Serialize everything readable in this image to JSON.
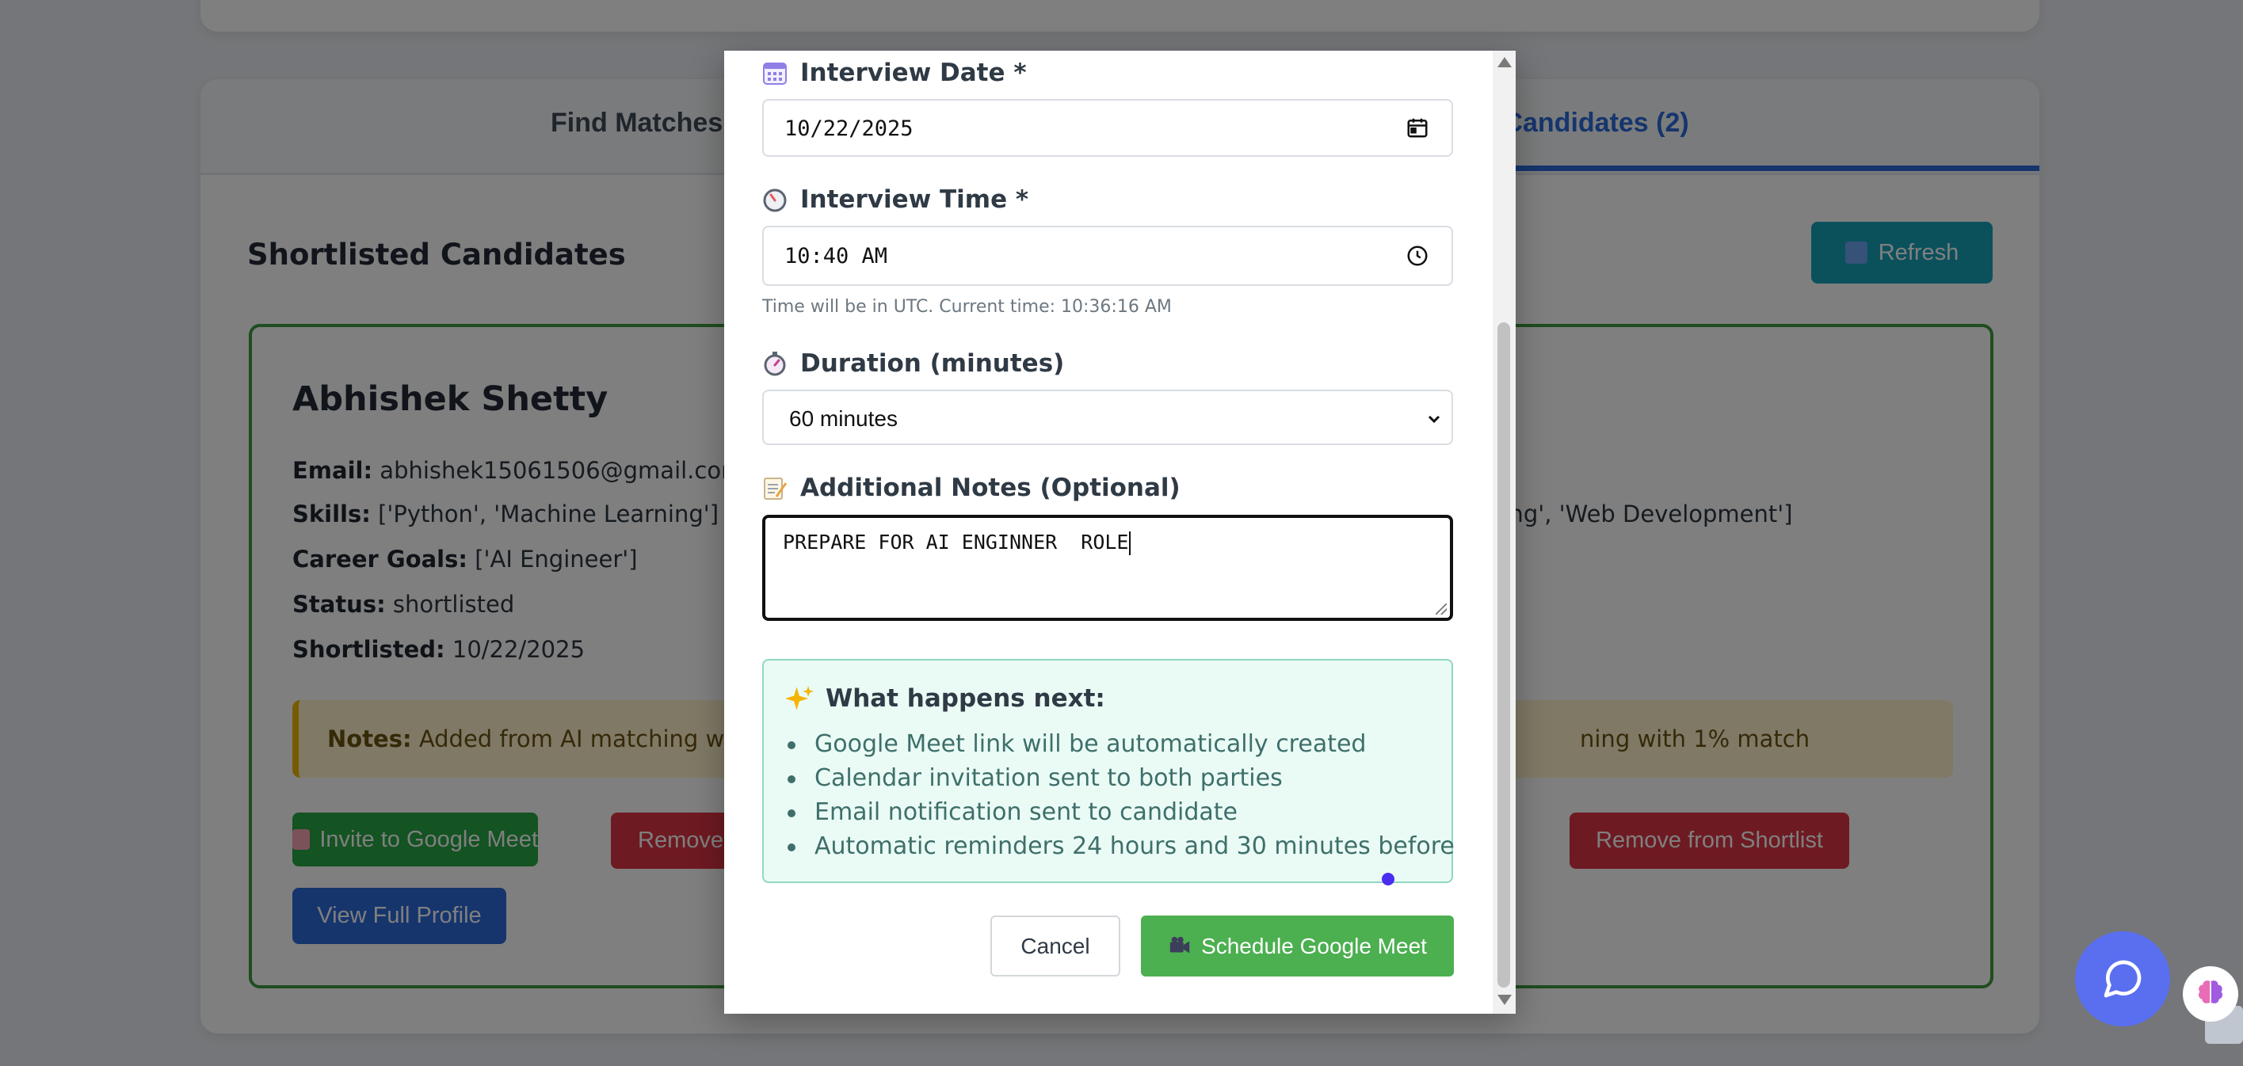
{
  "background": {
    "tabs": [
      {
        "label": "Find Matches"
      },
      {
        "label": "ted Candidates (2)"
      }
    ],
    "section_title": "Shortlisted Candidates",
    "refresh_label": "Refresh",
    "candidate": {
      "name": "Abhishek Shetty",
      "email_label": "Email:",
      "email": "abhishek15061506@gmail.com",
      "skills_label": "Skills:",
      "skills": "['Python', 'Machine Learning']",
      "goals_label": "Career Goals:",
      "goals": "['AI Engineer']",
      "status_label": "Status:",
      "status": "shortlisted",
      "shortlisted_label": "Shortlisted:",
      "shortlisted": "10/22/2025",
      "right_skills_fragment": "ning', 'Web Development']",
      "notes_label": "Notes:",
      "notes": "Added from AI matching with",
      "notes_right_fragment": "ning with 1% match"
    },
    "buttons": {
      "invite": "Invite to Google Meet",
      "remove_short": "Remove",
      "remove_full": "Remove from Shortlist",
      "view_profile": "View Full Profile"
    }
  },
  "modal": {
    "date_label": "Interview Date *",
    "date_value": "10/22/2025",
    "time_label": "Interview Time *",
    "time_value": "10:40 AM",
    "time_hint": "Time will be in UTC. Current time: 10:36:16 AM",
    "duration_label": "Duration (minutes)",
    "duration_value": "60 minutes",
    "notes_label": "Additional Notes (Optional)",
    "notes_value": "PREPARE FOR AI ENGINNER  ROLE",
    "next_title": "What happens next:",
    "next_items": [
      "Google Meet link will be automatically created",
      "Calendar invitation sent to both parties",
      "Email notification sent to candidate",
      "Automatic reminders 24 hours and 30 minutes before"
    ],
    "cancel_label": "Cancel",
    "schedule_label": "Schedule Google Meet"
  },
  "colors": {
    "primary": "#2d6bdb",
    "success": "#28a745",
    "danger": "#dc3545",
    "info": "#17a2b8",
    "chat": "#5a6ff0"
  }
}
